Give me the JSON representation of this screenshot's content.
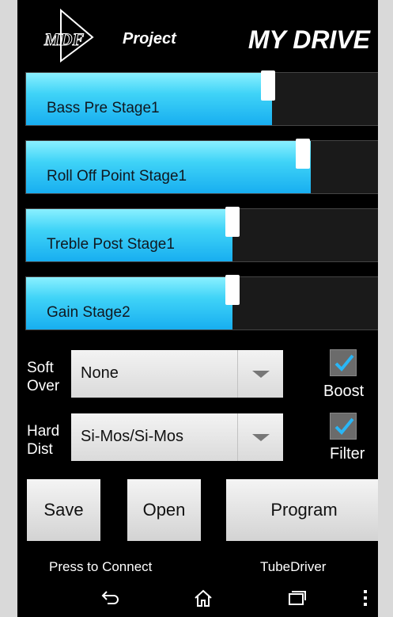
{
  "header": {
    "logo_text": "MDF",
    "project_label": "Project",
    "title": "MY DRIVE"
  },
  "sliders": [
    {
      "label": "Bass Pre Stage1",
      "level_pct": 69
    },
    {
      "label": "Roll Off Point Stage1",
      "level_pct": 80
    },
    {
      "label": "Treble Post Stage1",
      "level_pct": 58
    },
    {
      "label": "Gain Stage2",
      "level_pct": 58
    }
  ],
  "soft_over": {
    "label_line1": "Soft",
    "label_line2": "Over",
    "value": "None"
  },
  "hard_dist": {
    "label_line1": "Hard",
    "label_line2": "Dist",
    "value": "Si-Mos/Si-Mos"
  },
  "boost": {
    "label": "Boost",
    "checked": true
  },
  "filter": {
    "label": "Filter",
    "checked": true
  },
  "buttons": {
    "save": "Save",
    "open": "Open",
    "program": "Program"
  },
  "status": {
    "connect": "Press to Connect",
    "device": "TubeDriver"
  },
  "colors": {
    "accent": "#33ccf5",
    "check": "#29b6f6"
  },
  "nav_icons": [
    "back-icon",
    "home-icon",
    "recent-apps-icon",
    "overflow-menu-icon"
  ]
}
